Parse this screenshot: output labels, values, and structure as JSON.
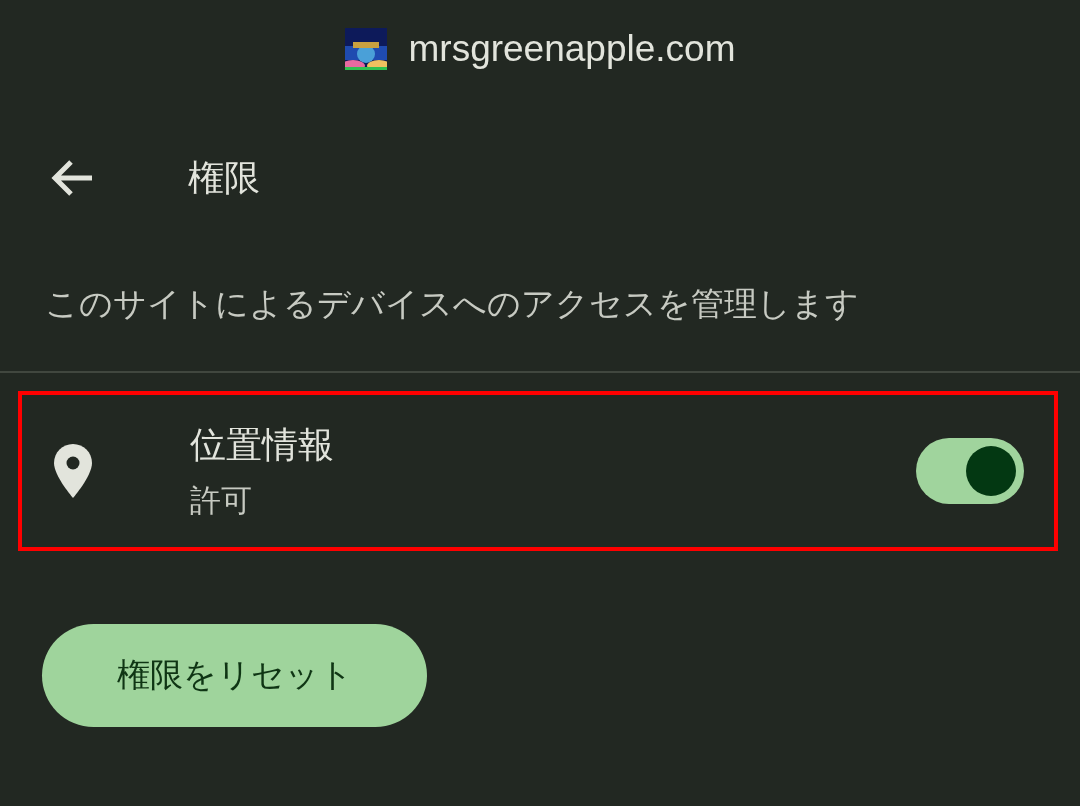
{
  "site": {
    "domain": "mrsgreenapple.com"
  },
  "header": {
    "title": "権限"
  },
  "description": "このサイトによるデバイスへのアクセスを管理します",
  "permissions": [
    {
      "label": "位置情報",
      "status": "許可",
      "on": true,
      "highlighted": true
    }
  ],
  "reset_button": "権限をリセット"
}
